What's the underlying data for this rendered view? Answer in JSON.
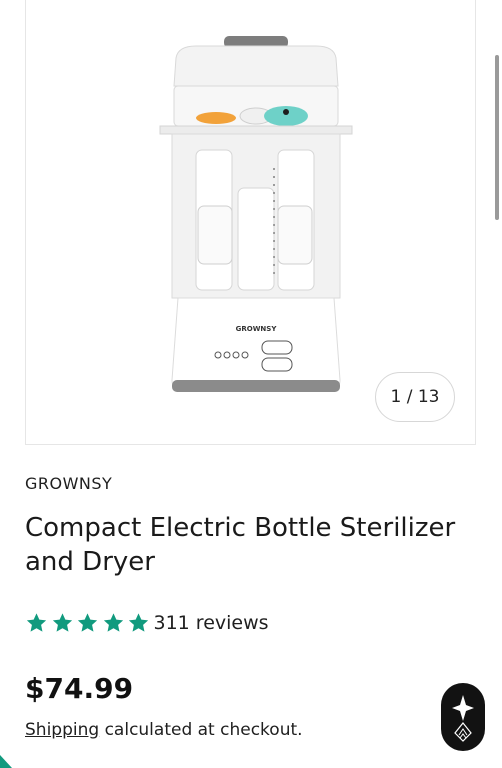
{
  "gallery": {
    "counter": "1 / 13",
    "image_label": "GROWNSY"
  },
  "product": {
    "brand": "GROWNSY",
    "title": "Compact Electric Bottle Sterilizer and Dryer",
    "rating": 5,
    "reviews_label": "311 reviews",
    "price": "$74.99",
    "shipping_link": "Shipping",
    "shipping_rest": " calculated at checkout."
  },
  "colors": {
    "star": "#119a7e",
    "fab": "#121212",
    "accent": "#119a7e"
  },
  "icons": {
    "rating": "star-icon",
    "fab": "diamond-logo-icon"
  }
}
